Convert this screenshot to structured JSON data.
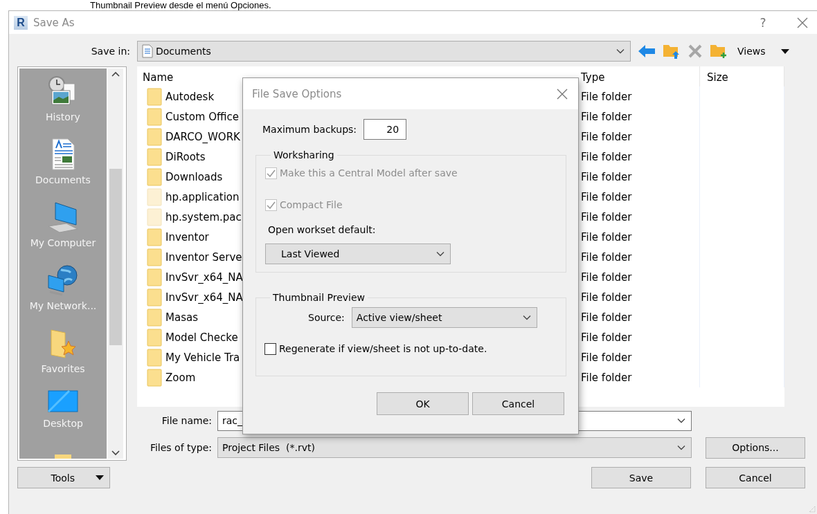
{
  "caption": "Thumbnail Preview desde el menú Opciones.",
  "window": {
    "logo": "R",
    "title": "Save As",
    "help": "?"
  },
  "save_in": {
    "label": "Save in:",
    "value": "Documents"
  },
  "toolbar": [
    {
      "kind": "back",
      "disabled": false
    },
    {
      "kind": "up",
      "disabled": false
    },
    {
      "kind": "delete",
      "disabled": true
    },
    {
      "kind": "new-folder",
      "disabled": false
    }
  ],
  "views": {
    "label": "Views"
  },
  "places": [
    {
      "kind": "history",
      "label": "History"
    },
    {
      "kind": "documents",
      "label": "Documents"
    },
    {
      "kind": "computer",
      "label": "My Computer"
    },
    {
      "kind": "network",
      "label": "My Network..."
    },
    {
      "kind": "favorites",
      "label": "Favorites"
    },
    {
      "kind": "desktop",
      "label": "Desktop"
    },
    {
      "kind": "folder"
    }
  ],
  "file_list": {
    "columns": [
      "Name",
      "Type",
      "Size"
    ],
    "rows": [
      {
        "name": "Autodesk",
        "type": "File folder",
        "hidden": false
      },
      {
        "name": "Custom Office",
        "type": "File folder",
        "hidden": false
      },
      {
        "name": "DARCO_WORK",
        "type": "File folder",
        "hidden": false
      },
      {
        "name": "DiRoots",
        "type": "File folder",
        "hidden": false
      },
      {
        "name": "Downloads",
        "type": "File folder",
        "hidden": false
      },
      {
        "name": "hp.application",
        "type": "File folder",
        "hidden": true
      },
      {
        "name": "hp.system.pac",
        "type": "File folder",
        "hidden": true
      },
      {
        "name": "Inventor",
        "type": "File folder",
        "hidden": false
      },
      {
        "name": "Inventor Serve",
        "type": "File folder",
        "hidden": false
      },
      {
        "name": "InvSvr_x64_NA",
        "type": "File folder",
        "hidden": false
      },
      {
        "name": "InvSvr_x64_NA",
        "type": "File folder",
        "hidden": false
      },
      {
        "name": "Masas",
        "type": "File folder",
        "hidden": false
      },
      {
        "name": "Model Checke",
        "type": "File folder",
        "hidden": false
      },
      {
        "name": "My Vehicle Tra",
        "type": "File folder",
        "hidden": false
      },
      {
        "name": "Zoom",
        "type": "File folder",
        "hidden": false
      }
    ]
  },
  "file_name": {
    "label": "File name:",
    "value": "rac_"
  },
  "file_type": {
    "label": "Files of type:",
    "value": "Project Files  (*.rvt)"
  },
  "buttons": {
    "tools": "Tools",
    "options": "Options...",
    "save": "Save",
    "cancel": "Cancel"
  },
  "dialog": {
    "title": "File Save Options",
    "max_backups": {
      "label": "Maximum backups:",
      "value": "20"
    },
    "worksharing": {
      "legend": "Worksharing",
      "options": [
        {
          "label": "Make this a Central Model after save",
          "checked": true,
          "disabled": true
        },
        {
          "label": "Compact File",
          "checked": true,
          "disabled": true
        }
      ],
      "workset_label": "Open workset default:",
      "workset_value": "Last Viewed"
    },
    "thumbnail": {
      "legend": "Thumbnail Preview",
      "source_label": "Source:",
      "source_value": "Active view/sheet",
      "regenerate": {
        "label": "Regenerate if view/sheet is not up-to-date.",
        "checked": false,
        "disabled": false
      }
    },
    "buttons": [
      "OK",
      "Cancel"
    ]
  }
}
